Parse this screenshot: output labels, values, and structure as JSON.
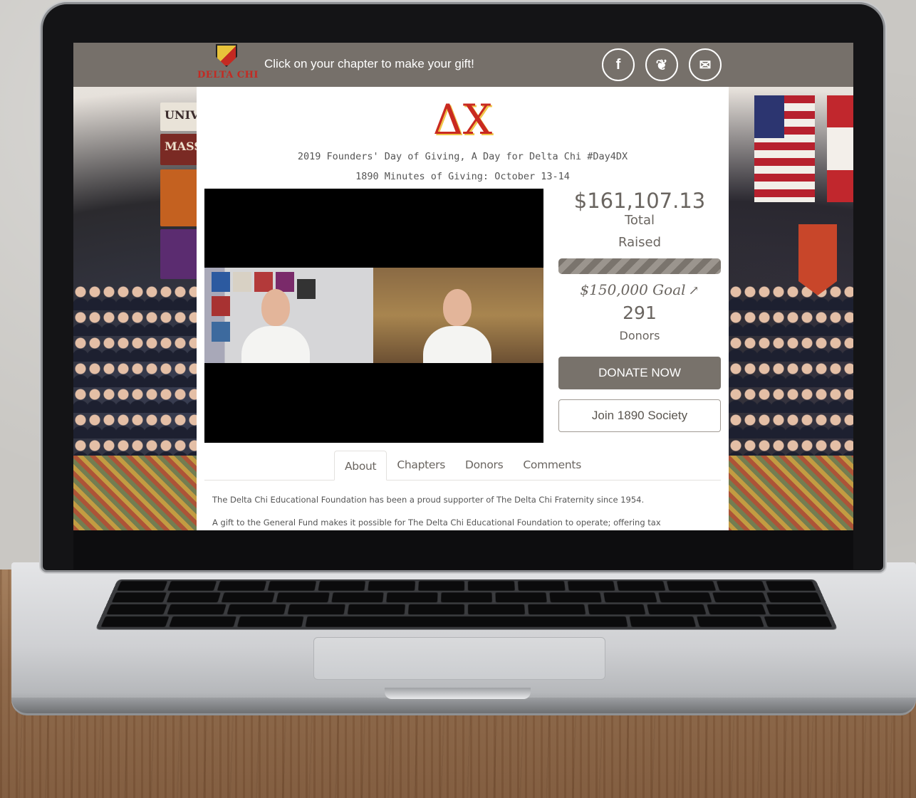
{
  "topbar": {
    "brand_name": "DELTA CHI",
    "cta_text": "Click on your chapter to make your gift!",
    "social": [
      {
        "icon": "facebook-icon",
        "glyph": "f"
      },
      {
        "icon": "twitter-icon",
        "glyph": "❦"
      },
      {
        "icon": "email-icon",
        "glyph": "✉"
      }
    ]
  },
  "background": {
    "banner_univ": "UNIV",
    "banner_mass": "MASS"
  },
  "campaign": {
    "logo_text": "ΔX",
    "title": "2019 Founders' Day of Giving, A Day for Delta Chi #Day4DX",
    "subtitle": "1890 Minutes of Giving: October 13-14"
  },
  "stats": {
    "total_amount": "$161,107.13",
    "total_word": "Total",
    "raised_word": "Raised",
    "progress_fraction": 1.0,
    "goal_text": "$150,000 Goal",
    "goal_arrow": "↗",
    "donor_count": "291",
    "donors_word": "Donors"
  },
  "buttons": {
    "donate": "DONATE NOW",
    "join": "Join 1890 Society"
  },
  "tabs": [
    {
      "label": "About",
      "active": true
    },
    {
      "label": "Chapters",
      "active": false
    },
    {
      "label": "Donors",
      "active": false
    },
    {
      "label": "Comments",
      "active": false
    }
  ],
  "about": {
    "p1": "The Delta Chi Educational Foundation has been a proud supporter of The Delta Chi Fraternity since 1954.",
    "p2": "A gift to the General Fund makes it possible for The Delta Chi Educational Foundation to operate; offering tax"
  },
  "colors": {
    "topbar_bg": "#76706a",
    "accent_red": "#c92a20",
    "button_bg": "#78726b"
  }
}
